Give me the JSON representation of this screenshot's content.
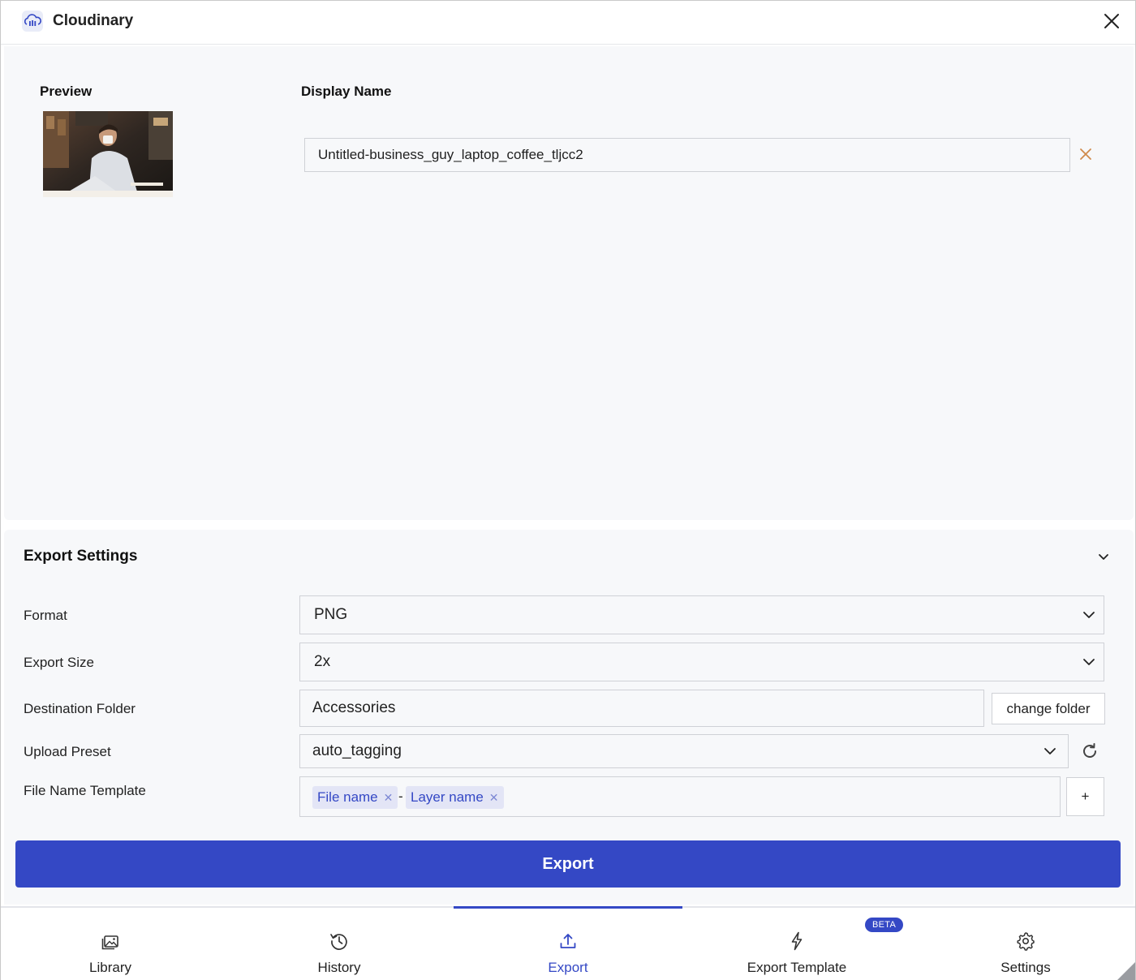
{
  "header": {
    "title": "Cloudinary",
    "logo_icon": "cloudinary-logo-icon",
    "close_icon": "close-icon"
  },
  "preview": {
    "preview_label": "Preview",
    "display_name_label": "Display Name",
    "display_name_value": "Untitled-business_guy_laptop_coffee_tljcc2",
    "clear_icon": "clear-x-icon"
  },
  "export_settings": {
    "title": "Export Settings",
    "format": {
      "label": "Format",
      "value": "PNG"
    },
    "export_size": {
      "label": "Export Size",
      "value": "2x"
    },
    "destination_folder": {
      "label": "Destination Folder",
      "value": "Accessories",
      "change_button": "change folder"
    },
    "upload_preset": {
      "label": "Upload Preset",
      "value": "auto_tagging"
    },
    "file_name_template": {
      "label": "File Name Template",
      "chips": [
        "File name",
        "Layer name"
      ],
      "separator": "-",
      "add_button": "+"
    },
    "export_button": "Export"
  },
  "nav": {
    "items": [
      {
        "label": "Library",
        "icon": "library-icon"
      },
      {
        "label": "History",
        "icon": "history-icon"
      },
      {
        "label": "Export",
        "icon": "upload-icon"
      },
      {
        "label": "Export Template",
        "icon": "lightning-icon"
      },
      {
        "label": "Settings",
        "icon": "gear-icon"
      }
    ],
    "active": "Export",
    "beta_badge": "BETA"
  },
  "colors": {
    "accent": "#3448c5",
    "panel_bg": "#f7f8fa",
    "clear_icon": "#d08a4c"
  }
}
